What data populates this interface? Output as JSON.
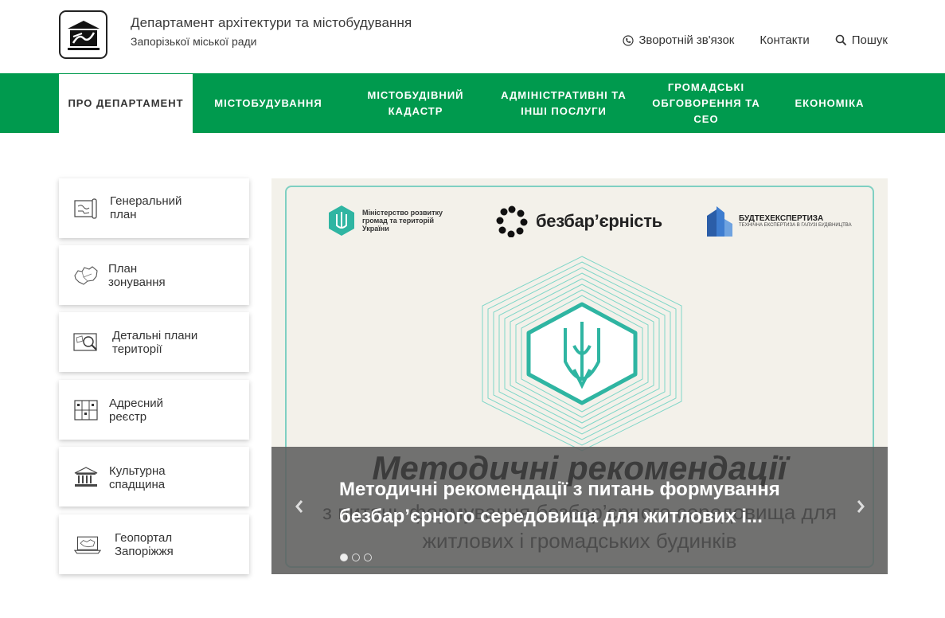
{
  "header": {
    "title": "Департамент архітектури та містобудування",
    "subtitle": "Запорізької міської ради",
    "links": [
      {
        "label": "Зворотній зв'язок",
        "icon": "phone-icon"
      },
      {
        "label": "Контакти"
      },
      {
        "label": "Пошук",
        "icon": "search-icon"
      }
    ]
  },
  "nav": {
    "items": [
      {
        "line1": "Про департамент",
        "line2": "",
        "active": true
      },
      {
        "line1": "Містобудування",
        "line2": ""
      },
      {
        "line1": "Містобудівний",
        "line2": "кадастр"
      },
      {
        "line1": "Адміністративні та",
        "line2": "інші послуги"
      },
      {
        "line1": "Громадські",
        "line2": "обговорення та СЕО"
      },
      {
        "line1": "Економіка",
        "line2": ""
      }
    ]
  },
  "sidebar": {
    "items": [
      {
        "line1": "Генеральний",
        "line2": "план",
        "icon": "general-plan-icon"
      },
      {
        "line1": "План",
        "line2": "зонування",
        "icon": "zoning-map-icon"
      },
      {
        "line1": "Детальні плани",
        "line2": "території",
        "icon": "detailed-plan-icon"
      },
      {
        "line1": "Адресний",
        "line2": "реєстр",
        "icon": "address-registry-icon"
      },
      {
        "line1": "Культурна",
        "line2": "спадщина",
        "icon": "heritage-building-icon"
      },
      {
        "line1": "Геопортал",
        "line2": "Запоріжжя",
        "icon": "geoportal-laptop-icon"
      }
    ]
  },
  "slider": {
    "partners": {
      "ministry": [
        "Міністерство розвитку",
        "громад та територій",
        "України"
      ],
      "bezbar": "безбар’єрність",
      "budtech_title": "БУДТЕХЕКСПЕРТИЗА",
      "budtech_sub": "ТЕХНІЧНА ЕКСПЕРТИЗА В ГАЛУЗІ БУДІВНИЦТВА"
    },
    "background_heading": "Методичні рекомендації",
    "background_line1": "з питань формування безбар’єрного середовища для",
    "background_line2": "житлових і громадських будинків",
    "caption_line1": "Методичні рекомендації з питань формування",
    "caption_line2": "безбар’єрного середовища для житлових і...",
    "slide_count": 3,
    "active_slide": 1,
    "accent_color": "#2fb5a2"
  },
  "colors": {
    "nav_green": "#009a4e",
    "text": "#333333"
  }
}
